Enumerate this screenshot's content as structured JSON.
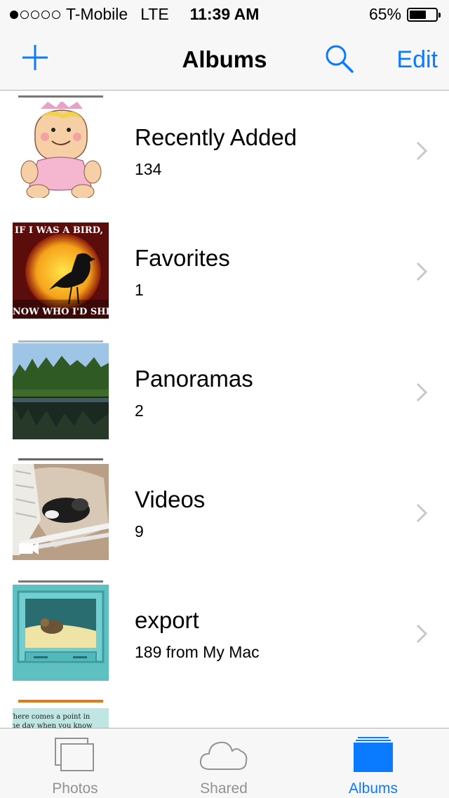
{
  "status_bar": {
    "signal_dots": [
      true,
      false,
      false,
      false,
      false
    ],
    "carrier": "T-Mobile",
    "network": "LTE",
    "time": "11:39 AM",
    "battery_percent_text": "65%",
    "battery_level": 0.65
  },
  "nav": {
    "title": "Albums",
    "add_icon": "plus-icon",
    "search_icon": "search-icon",
    "edit_label": "Edit",
    "accent_color": "#0a7afe"
  },
  "albums": [
    {
      "name": "Recently Added",
      "count": "134",
      "thumb_icon": "cartoon-baby-thumbnail"
    },
    {
      "name": "Favorites",
      "count": "1",
      "thumb_icon": "bird-meme-thumbnail",
      "thumb_text_top": "IF I WAS A BIRD,",
      "thumb_text_bottom": "I KNOW WHO I'D SHIT ON"
    },
    {
      "name": "Panoramas",
      "count": "2",
      "thumb_icon": "lake-forest-thumbnail"
    },
    {
      "name": "Videos",
      "count": "9",
      "thumb_icon": "puppy-video-thumbnail"
    },
    {
      "name": "export",
      "count": "189 from My Mac",
      "thumb_icon": "dog-bed-thumbnail"
    },
    {
      "name": "",
      "count": "",
      "thumb_icon": "text-quote-thumbnail",
      "thumb_text": "There comes a point in the day when you know"
    }
  ],
  "tabs": [
    {
      "label": "Photos",
      "icon": "photos-icon",
      "active": false
    },
    {
      "label": "Shared",
      "icon": "cloud-icon",
      "active": false
    },
    {
      "label": "Albums",
      "icon": "albums-icon",
      "active": true
    }
  ],
  "colors": {
    "inactive_tab": "#929292",
    "active_tab": "#0a7afe"
  }
}
